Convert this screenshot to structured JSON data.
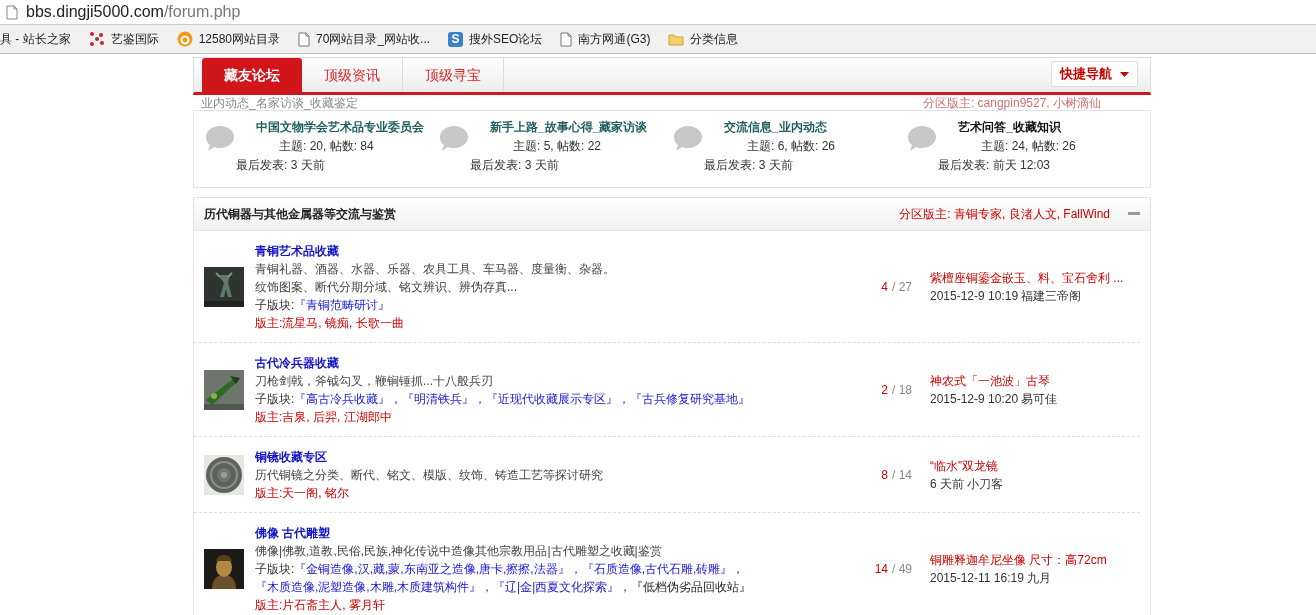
{
  "address_bar": {
    "host": "bbs.dingji5000.com",
    "path": "/forum.php"
  },
  "bookmarks": [
    {
      "label": "具 - 站长之家",
      "kind": "none"
    },
    {
      "label": "艺鉴国际",
      "kind": "dots"
    },
    {
      "label": "12580网站目录",
      "kind": "badge"
    },
    {
      "label": "70网站目录_网站收...",
      "kind": "page"
    },
    {
      "label": "搜外SEO论坛",
      "kind": "letter",
      "icon_text": "S"
    },
    {
      "label": "南方网通(G3)",
      "kind": "page"
    },
    {
      "label": "分类信息",
      "kind": "folder"
    }
  ],
  "nav": {
    "tabs": [
      {
        "label": "藏友论坛",
        "selected": true
      },
      {
        "label": "顶级资讯",
        "selected": false
      },
      {
        "label": "顶级寻宝",
        "selected": false
      }
    ],
    "quick_nav": "快捷导航"
  },
  "faded_texts": [
    "业内动态_名家访谈_收藏鉴定",
    "分区版主: cangpin9527, 小树滴仙"
  ],
  "top_forums": [
    {
      "name": "中国文物学会艺术品专业委员会",
      "color": "#1f5f5f",
      "stats": "主题: 20, 帖数: 84",
      "last": "最后发表: 3 天前"
    },
    {
      "name": "新手上路_故事心得_藏家访谈",
      "color": "#1f5f5f",
      "stats": "主题: 5, 帖数: 22",
      "last": "最后发表: 3 天前"
    },
    {
      "name": "交流信息_业内动态",
      "color": "#1f5f5f",
      "stats": "主题: 6, 帖数: 26",
      "last": "最后发表: 3 天前"
    },
    {
      "name": "艺术问答_收藏知识",
      "color": "#111111",
      "stats": "主题: 24, 帖数: 26",
      "last": "最后发表: 前天 12:03"
    }
  ],
  "section": {
    "title": "历代铜器与其他金属器等交流与鉴赏",
    "moderators": "分区版主: 青铜专家, 良渚人文, FallWind",
    "expanded": true
  },
  "subforum_separator": "，",
  "forums": [
    {
      "name": "青铜艺术品收藏",
      "kind": "picture",
      "description": [
        "青铜礼器、酒器、水器、乐器、农具工具、车马器、度量衡、杂器。",
        "纹饰图案、断代分期分域、铭文辨识、辨伪存真..."
      ],
      "subforums_label": "子版块:",
      "subforums": [
        {
          "name": "『青铜范畴研讨』",
          "kind": "link"
        }
      ],
      "moderators_label": "版主:",
      "moderators": "流星马, 镜痴, 长歌一曲",
      "today": "4",
      "total": "/ 27",
      "last_title": "紫檀座铜鎏金嵌玉、料、宝石舍利 ...",
      "last_meta": "2015-12-9 10:19 福建三帝阁"
    },
    {
      "name": "古代冷兵器收藏",
      "kind": "picture",
      "description": [
        "刀枪剑戟，斧钺勾叉，鞭锏锤抓...十八般兵刃"
      ],
      "subforums_label": "子版块:",
      "subforums": [
        {
          "name": "『高古冷兵收藏』",
          "kind": "link"
        },
        {
          "name": "『明清铁兵』",
          "kind": "link"
        },
        {
          "name": "『近现代收藏展示专区』",
          "kind": "link"
        },
        {
          "name": "『古兵修复研究基地』",
          "kind": "link"
        }
      ],
      "moderators_label": "版主:",
      "moderators": "吉泉, 后羿, 江湖郎中",
      "today": "2",
      "total": "/ 18",
      "last_title": "神农式「一池波」古琴",
      "last_meta": "2015-12-9 10:20 易可佳"
    },
    {
      "name": "铜镜收藏专区",
      "kind": "picture",
      "description": [
        "历代铜镜之分类、断代、铭文、模版、纹饰、铸造工艺等探讨研究"
      ],
      "moderators_label": "版主:",
      "moderators": "天一阁, 铭尔",
      "today": "8",
      "total": "/ 14",
      "last_title": "“临水”双龙镜",
      "last_meta": "6 天前 小刀客"
    },
    {
      "name": "佛像 古代雕塑",
      "kind": "picture",
      "description": [
        "佛像|佛教,道教,民俗,民族,神化传说中造像其他宗教用品|古代雕塑之收藏|鉴赏"
      ],
      "subforums_label": "子版块:",
      "subforums": [
        {
          "name": "『金铜造像,汉,藏,蒙,东南亚之造像,唐卡,擦擦,法器』",
          "kind": "link"
        },
        {
          "name": "『石质造像,古代石雕,砖雕』",
          "kind": "link"
        },
        {
          "name": "『木质造像,泥塑造像,木雕,木质建筑构件』",
          "kind": "link"
        },
        {
          "name": "『辽|金|西夏文化探索』",
          "kind": "link"
        },
        {
          "name": "『低档伪劣品回收站』",
          "kind": "plain"
        }
      ],
      "moderators_label": "版主:",
      "moderators": "片石斋主人, 雾月轩",
      "today": "14",
      "total": "/ 49",
      "last_title": "铜雕释迦牟尼坐像 尺寸：高72cm",
      "last_meta": "2015-12-11 16:19 九月"
    }
  ]
}
